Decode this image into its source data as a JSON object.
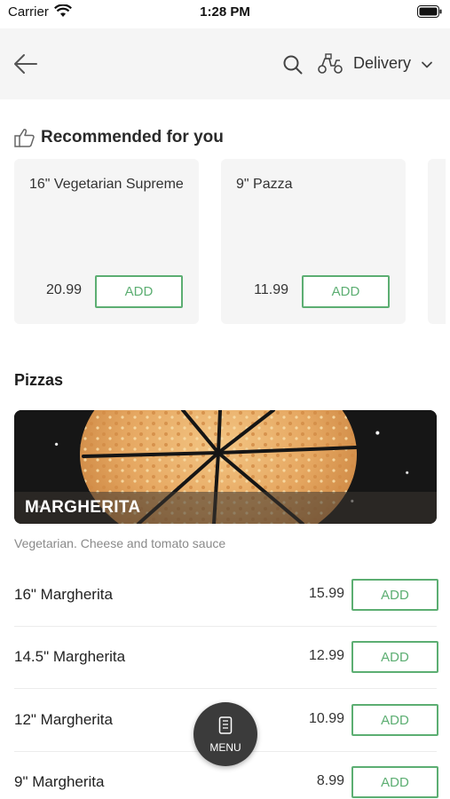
{
  "status": {
    "carrier": "Carrier",
    "time": "1:28 PM"
  },
  "header": {
    "delivery_label": "Delivery"
  },
  "recommended": {
    "title": "Recommended for you",
    "items": [
      {
        "name": "16\" Vegetarian Supreme",
        "price": "20.99",
        "add_label": "ADD"
      },
      {
        "name": "9\" Pazza",
        "price": "11.99",
        "add_label": "ADD"
      }
    ]
  },
  "section": {
    "title": "Pizzas",
    "banner_label": "MARGHERITA",
    "description": "Vegetarian. Cheese and tomato sauce",
    "items": [
      {
        "name": "16\" Margherita",
        "price": "15.99",
        "add_label": "ADD"
      },
      {
        "name": "14.5\" Margherita",
        "price": "12.99",
        "add_label": "ADD"
      },
      {
        "name": "12\" Margherita",
        "price": "10.99",
        "add_label": "ADD"
      },
      {
        "name": "9\" Margherita",
        "price": "8.99",
        "add_label": "ADD"
      }
    ]
  },
  "fab": {
    "label": "MENU"
  },
  "colors": {
    "accent": "#5cae72",
    "header_bg": "#f5f5f5",
    "card_bg": "#f5f5f5",
    "fab_bg": "#3b3b3b"
  },
  "icons": [
    "wifi-icon",
    "battery-icon",
    "back-arrow-icon",
    "search-icon",
    "scooter-icon",
    "chevron-down-icon",
    "thumbs-up-icon",
    "menu-icon"
  ]
}
